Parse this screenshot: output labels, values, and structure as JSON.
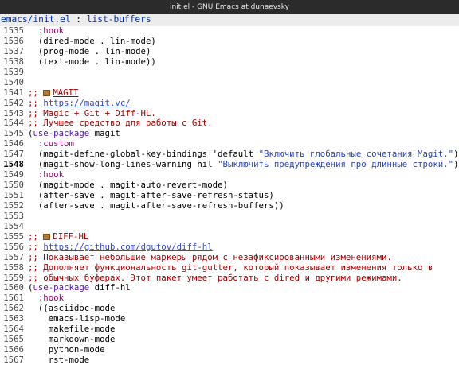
{
  "window": {
    "title": "init.el - GNU Emacs at dunaevsky"
  },
  "header": {
    "path": "emacs/init.el",
    "separator": " : ",
    "package": "list-buffers"
  },
  "editor": {
    "current_line": "1548",
    "lines": [
      {
        "num": "1535",
        "segments": [
          {
            "text": "  "
          },
          {
            "text": ":hook",
            "cls": "key"
          }
        ]
      },
      {
        "num": "1536",
        "segments": [
          {
            "text": "  (dired-mode . lin-mode)"
          }
        ]
      },
      {
        "num": "1537",
        "segments": [
          {
            "text": "  (prog-mode . lin-mode)"
          }
        ]
      },
      {
        "num": "1538",
        "segments": [
          {
            "text": "  (text-mode . lin-mode))"
          }
        ]
      },
      {
        "num": "1539",
        "segments": []
      },
      {
        "num": "1540",
        "segments": []
      },
      {
        "num": "1541",
        "segments": [
          {
            "text": ";; ",
            "cls": "com"
          },
          {
            "icon": "package-icon"
          },
          {
            "text": "MAGIT",
            "cls": "com",
            "u": true
          }
        ]
      },
      {
        "num": "1542",
        "segments": [
          {
            "text": ";; ",
            "cls": "com"
          },
          {
            "text": "https://magit.vc/",
            "cls": "link"
          }
        ]
      },
      {
        "num": "1543",
        "segments": [
          {
            "text": ";; Magic + Git + Diff-HL.",
            "cls": "com"
          }
        ]
      },
      {
        "num": "1544",
        "segments": [
          {
            "text": ";; Лучшее средство для работы с Git.",
            "cls": "com"
          }
        ]
      },
      {
        "num": "1545",
        "segments": [
          {
            "text": "("
          },
          {
            "text": "use-package",
            "cls": "kw"
          },
          {
            "text": " magit"
          }
        ]
      },
      {
        "num": "1546",
        "segments": [
          {
            "text": "  "
          },
          {
            "text": ":custom",
            "cls": "key"
          }
        ]
      },
      {
        "num": "1547",
        "segments": [
          {
            "text": "  (magit-define-global-key-bindings 'default "
          },
          {
            "text": "\"Включить глобальные сочетания Magit.\"",
            "cls": "str"
          },
          {
            "text": ")"
          }
        ]
      },
      {
        "num": "1548",
        "segments": [
          {
            "text": "  (magit-show-long-lines-warning nil "
          },
          {
            "text": "\"Выключить предупреждения про длинные строки.\"",
            "cls": "str"
          },
          {
            "text": ")"
          }
        ]
      },
      {
        "num": "1549",
        "segments": [
          {
            "text": "  "
          },
          {
            "text": ":hook",
            "cls": "key"
          }
        ]
      },
      {
        "num": "1550",
        "segments": [
          {
            "text": "  (magit-mode . magit-auto-revert-mode)"
          }
        ]
      },
      {
        "num": "1551",
        "segments": [
          {
            "text": "  (after-save . magit-after-save-refresh-status)"
          }
        ]
      },
      {
        "num": "1552",
        "segments": [
          {
            "text": "  (after-save . magit-after-save-refresh-buffers))"
          }
        ]
      },
      {
        "num": "1553",
        "segments": []
      },
      {
        "num": "1554",
        "segments": []
      },
      {
        "num": "1555",
        "segments": [
          {
            "text": ";; ",
            "cls": "com"
          },
          {
            "icon": "package-icon"
          },
          {
            "text": "DIFF-HL",
            "cls": "com"
          }
        ]
      },
      {
        "num": "1556",
        "segments": [
          {
            "text": ";; ",
            "cls": "com"
          },
          {
            "text": "https://github.com/dgutov/diff-hl",
            "cls": "link"
          }
        ]
      },
      {
        "num": "1557",
        "segments": [
          {
            "text": ";; Показывает небольшие маркеры рядом с незафиксированными изменениями.",
            "cls": "com"
          }
        ]
      },
      {
        "num": "1558",
        "segments": [
          {
            "text": ";; Дополняет функциональность git-gutter, который показывает изменения только в",
            "cls": "com"
          }
        ]
      },
      {
        "num": "1559",
        "segments": [
          {
            "text": ";; обычных буферах. Этот пакет умеет работать с dired и другими режимами.",
            "cls": "com"
          }
        ]
      },
      {
        "num": "1560",
        "segments": [
          {
            "text": "("
          },
          {
            "text": "use-package",
            "cls": "kw"
          },
          {
            "text": " diff-hl"
          }
        ]
      },
      {
        "num": "1561",
        "segments": [
          {
            "text": "  "
          },
          {
            "text": ":hook",
            "cls": "key"
          }
        ]
      },
      {
        "num": "1562",
        "segments": [
          {
            "text": "  ((asciidoc-mode"
          }
        ]
      },
      {
        "num": "1563",
        "segments": [
          {
            "text": "    emacs-lisp-mode"
          }
        ]
      },
      {
        "num": "1564",
        "segments": [
          {
            "text": "    makefile-mode"
          }
        ]
      },
      {
        "num": "1565",
        "segments": [
          {
            "text": "    markdown-mode"
          }
        ]
      },
      {
        "num": "1566",
        "segments": [
          {
            "text": "    python-mode"
          }
        ]
      },
      {
        "num": "1567",
        "segments": [
          {
            "text": "    rst-mode"
          }
        ]
      }
    ]
  }
}
